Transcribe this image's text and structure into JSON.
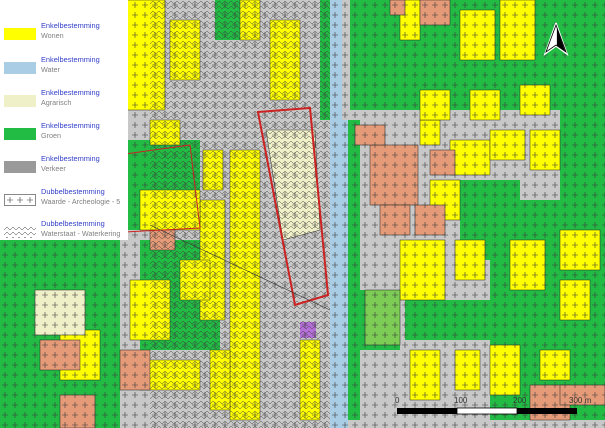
{
  "legend": {
    "items": [
      {
        "title": "Enkelbestemming",
        "subtitle": "Wonen",
        "color": "#ffff00",
        "pattern": "solid"
      },
      {
        "title": "Enkelbestemming",
        "subtitle": "Water",
        "color": "#aacde6",
        "pattern": "solid"
      },
      {
        "title": "Enkelbestemming",
        "subtitle": "Agrarisch",
        "color": "#f0f0c8",
        "pattern": "solid"
      },
      {
        "title": "Enkelbestemming",
        "subtitle": "Groen",
        "color": "#22bb44",
        "pattern": "solid"
      },
      {
        "title": "Enkelbestemming",
        "subtitle": "Verkeer",
        "color": "#9a9a9a",
        "pattern": "solid"
      },
      {
        "title": "Dubbelbestemming",
        "subtitle": "Waarde - Archeologie - 5",
        "color": "#ffffff",
        "pattern": "cross"
      },
      {
        "title": "Dubbelbestemming",
        "subtitle": "Waterstaat - Waterkering",
        "color": "#ffffff",
        "pattern": "zigzag"
      }
    ]
  },
  "north_arrow": {
    "icon": "north-arrow-icon"
  },
  "scale_bar": {
    "labels": [
      "0",
      "100",
      "200",
      "300 m"
    ],
    "icon": "scale-bar-icon"
  },
  "colors": {
    "wonen": "#ffff00",
    "groen": "#22bb44",
    "verkeer": "#c8c8c8",
    "water": "#aacde6",
    "agrarisch": "#f0f0c8",
    "gemengd": "#e59b78",
    "maatschappelijk": "#b56fd8",
    "plangebied": "#cc2222"
  }
}
